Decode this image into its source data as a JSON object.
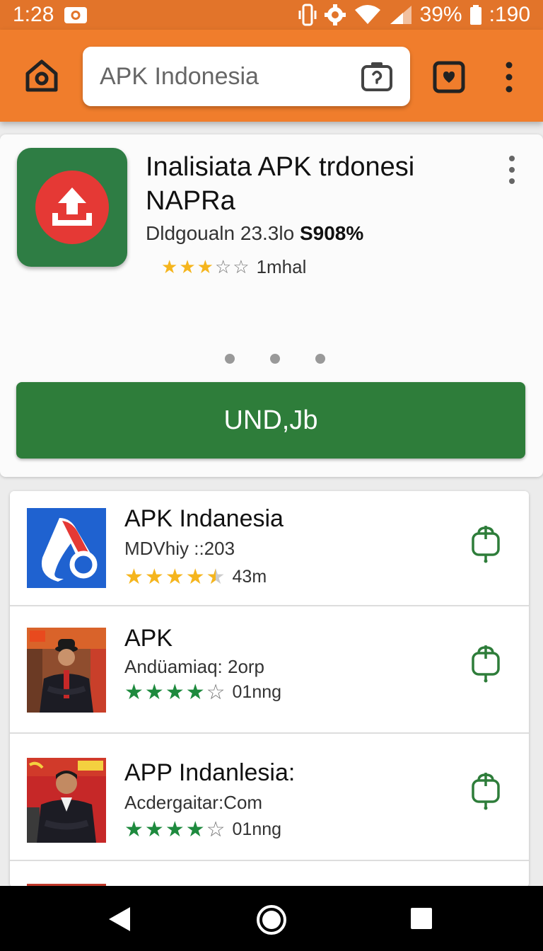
{
  "status_bar": {
    "time": "1:28",
    "battery": "39%",
    "extra": ":190"
  },
  "toolbar": {
    "search_text": "APK Indonesia",
    "accent": "#f07d2c"
  },
  "featured": {
    "title": "Inalisiata APK trdonesi NAPRa",
    "meta": "Dldgoualn 23.3lo",
    "meta_bold": "S908%",
    "rating_stars": 3,
    "rating_text": "1mhal",
    "install_label": "UND,Jb",
    "carousel_pages": 3,
    "icon_color": "#2e7d44",
    "button_color": "#2e7d3a"
  },
  "apps": [
    {
      "title": "APK Indanesia",
      "subtitle": "MDVhiy ::203",
      "rating_stars": 4.5,
      "rating_text": "43m",
      "star_color": "#f5b51d",
      "thumb_icon": "droplet-logo-icon"
    },
    {
      "title": "APK",
      "subtitle": "Andüamiaq: 2orp",
      "rating_stars": 4,
      "rating_text": "01nng",
      "star_color": "#1e8a3e",
      "thumb_icon": "person-photo"
    },
    {
      "title": "APP Indanlesia:",
      "subtitle": "Acdergaitar:Com",
      "rating_stars": 4,
      "rating_text": "01nng",
      "star_color": "#1e8a3e",
      "thumb_icon": "person-photo"
    }
  ]
}
